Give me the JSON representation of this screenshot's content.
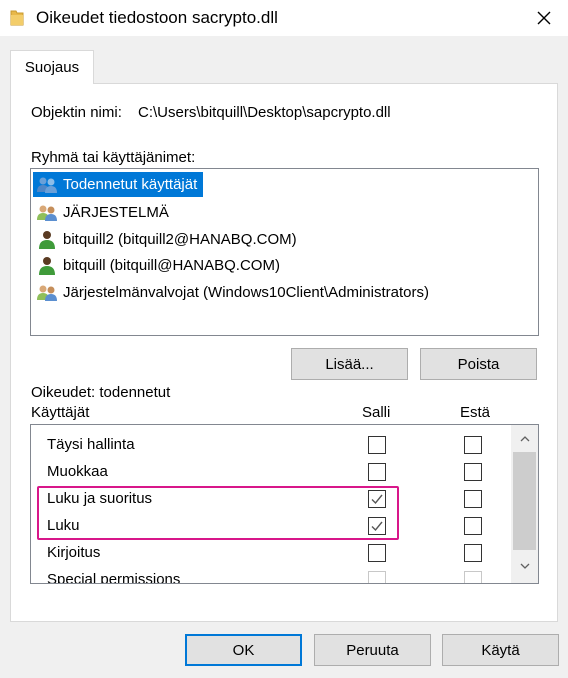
{
  "window": {
    "title": "Oikeudet tiedostoon sacrypto.dll"
  },
  "tabs": [
    {
      "label": "Suojaus"
    }
  ],
  "object_name": {
    "label": "Objektin nimi:",
    "value": "C:\\Users\\bitquill\\Desktop\\sapcrypto.dll"
  },
  "principals": {
    "label": "Ryhmä tai käyttäjänimet:",
    "items": [
      {
        "name": "Todennetut käyttäjät",
        "icon": "users-group-icon",
        "selected": true
      },
      {
        "name": "JÄRJESTELMÄ",
        "icon": "users-group-icon",
        "selected": false
      },
      {
        "name": "bitquill2 (bitquill2@HANABQ.COM)",
        "icon": "user-icon",
        "selected": false
      },
      {
        "name": "bitquill (bitquill@HANABQ.COM)",
        "icon": "user-icon",
        "selected": false
      },
      {
        "name": "Järjestelmänvalvojat (Windows10Client\\Administrators)",
        "icon": "users-group-icon",
        "selected": false
      }
    ]
  },
  "principal_buttons": {
    "add": "Lisää...",
    "remove": "Poista"
  },
  "permissions": {
    "header_line1": "Oikeudet: todennetut",
    "header_line2": "Käyttäjät",
    "allow_header": "Salli",
    "deny_header": "Estä",
    "rows": [
      {
        "name": "Täysi hallinta",
        "allow": false,
        "deny": false
      },
      {
        "name": "Muokkaa",
        "allow": false,
        "deny": false
      },
      {
        "name": "Luku ja suoritus",
        "allow": true,
        "deny": false
      },
      {
        "name": "Luku",
        "allow": true,
        "deny": false
      },
      {
        "name": "Kirjoitus",
        "allow": false,
        "deny": false
      },
      {
        "name": "Special permissions",
        "allow": false,
        "deny": false
      }
    ]
  },
  "footer": {
    "ok": "OK",
    "cancel": "Peruuta",
    "apply": "Käytä"
  },
  "colors": {
    "selection": "#0078d7",
    "highlight": "#d8178a",
    "folder": "#e8b84a"
  }
}
